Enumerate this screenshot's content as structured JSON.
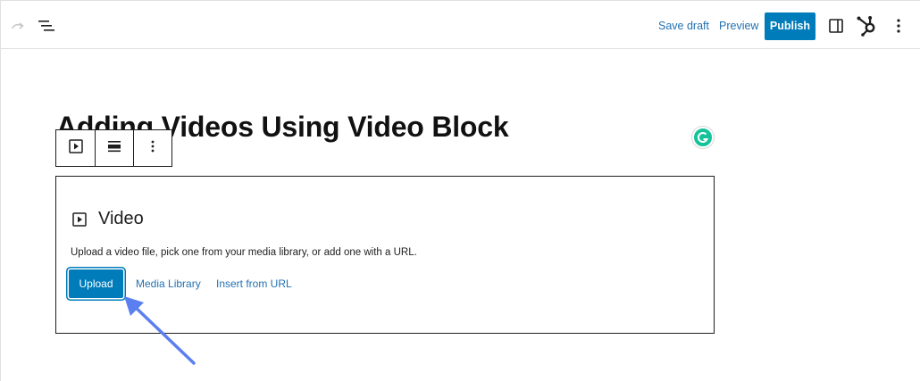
{
  "toolbar": {
    "save_draft": "Save draft",
    "preview": "Preview",
    "publish": "Publish",
    "icons": [
      "redo-icon",
      "document-outline-icon",
      "settings-sidebar-icon",
      "hubspot-icon",
      "more-options-icon"
    ]
  },
  "post": {
    "title": "Adding Videos Using Video Block"
  },
  "block_toolbar": {
    "icons": [
      "video-block-icon",
      "align-icon",
      "more-vertical-icon"
    ]
  },
  "video_block": {
    "title": "Video",
    "instructions": "Upload a video file, pick one from your media library, or add one with a URL.",
    "upload_label": "Upload",
    "media_library_label": "Media Library",
    "insert_url_label": "Insert from URL"
  },
  "colors": {
    "accent": "#007cba",
    "link": "#2271b1",
    "grammarly": "#15c39a",
    "annotation_arrow": "#5b7ff0"
  }
}
